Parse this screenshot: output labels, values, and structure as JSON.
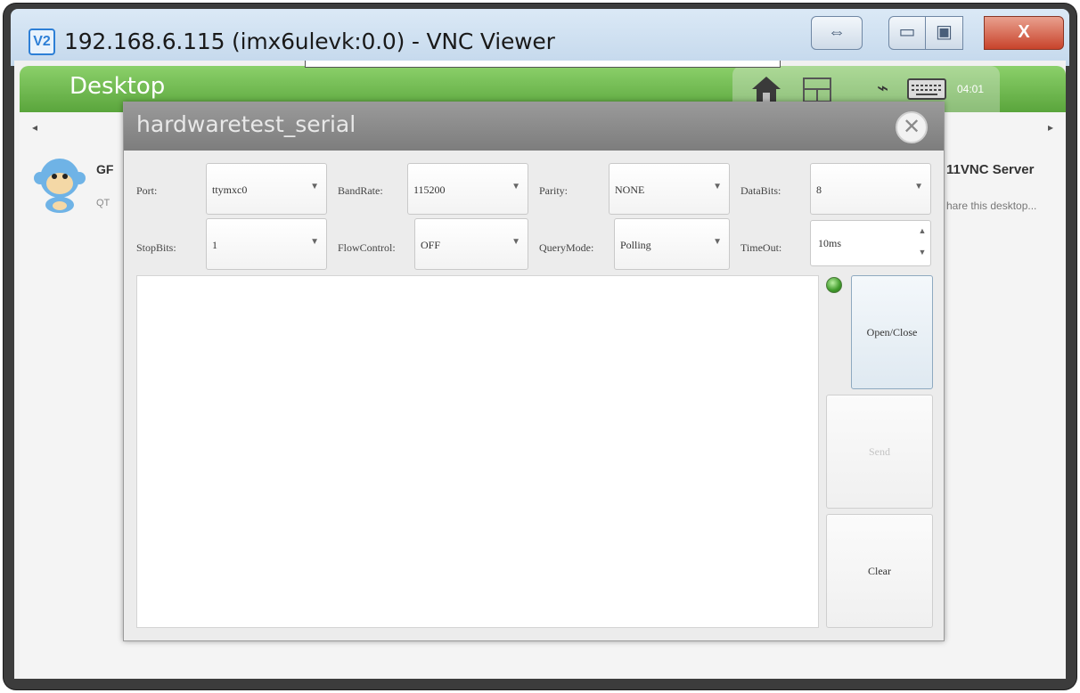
{
  "window": {
    "logo": "V2",
    "title": "192.168.6.115 (imx6ulevk:0.0) - VNC Viewer",
    "buttons": {
      "arrows": "⇔",
      "minimize": "▭",
      "maximize": "▣",
      "close": "X"
    }
  },
  "remote": {
    "title": "Desktop",
    "clock": "04:01",
    "scroll_left": "◂",
    "scroll_right": "▸",
    "apps": {
      "left_name": "GF",
      "left_desc": "QT",
      "right_name": "11VNC Server",
      "right_desc": "hare this desktop..."
    }
  },
  "dialog": {
    "title": "hardwaretest_serial",
    "close_glyph": "✕",
    "fields": {
      "port": {
        "label": "Port:",
        "value": "ttymxc0"
      },
      "baudrate": {
        "label": "BandRate:",
        "value": "115200"
      },
      "parity": {
        "label": "Parity:",
        "value": "NONE"
      },
      "databits": {
        "label": "DataBits:",
        "value": "8"
      },
      "stopbits": {
        "label": "StopBits:",
        "value": "1"
      },
      "flowcontrol": {
        "label": "FlowControl:",
        "value": "OFF"
      },
      "querymode": {
        "label": "QueryMode:",
        "value": "Polling"
      },
      "timeout": {
        "label": "TimeOut:",
        "value": "10ms"
      }
    },
    "dropdown_glyph": "▼",
    "spin_up_glyph": "▲",
    "spin_down_glyph": "▼",
    "buttons": {
      "open_close": "Open/Close",
      "send": "Send",
      "clear": "Clear"
    },
    "led_color": "#3f9a2a"
  }
}
